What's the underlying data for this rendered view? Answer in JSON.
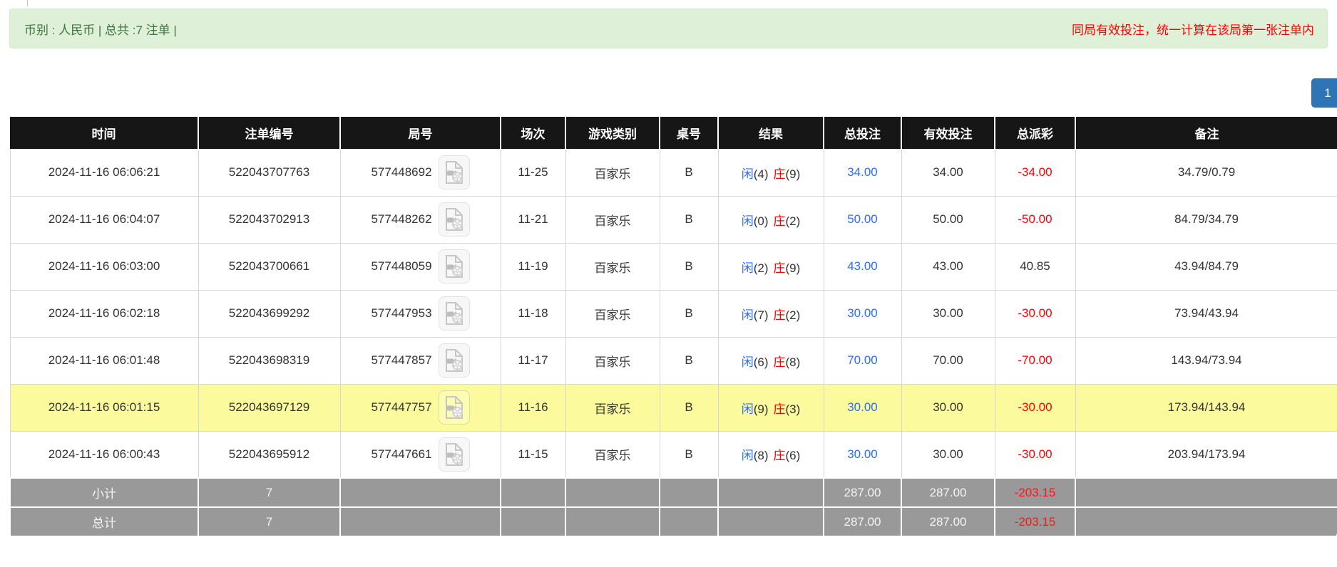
{
  "banner": {
    "left_text": "币别 : 人民币 | 总共 :7 注单 |",
    "right_text": "同局有效投注，统一计算在该局第一张注单内"
  },
  "pagination": {
    "page": "1"
  },
  "icons": {
    "round_action_icon": "video-replay-file-icon"
  },
  "colors": {
    "header_bg": "#161616",
    "banner_bg": "#dff0d8",
    "banner_text": "#3c763d",
    "notice_red": "#ff0000",
    "highlight_row": "#fbfb9d",
    "footer_bg": "#999999",
    "link_blue": "#2b6ff0",
    "player_blue": "#2b6ff0",
    "banker_red": "#ff0000",
    "negative_red": "#ff0000",
    "pagination_bg": "#2e75b6"
  },
  "table": {
    "columns": [
      "时间",
      "注单编号",
      "局号",
      "场次",
      "游戏类别",
      "桌号",
      "结果",
      "总投注",
      "有效投注",
      "总派彩",
      "备注"
    ],
    "rows": [
      {
        "time": "2024-11-16 06:06:21",
        "bet_id": "522043707763",
        "round_id": "577448692",
        "session": "11-25",
        "game": "百家乐",
        "table_no": "B",
        "result": {
          "player": "闲",
          "player_score": "(4)",
          "banker": "庄",
          "banker_score": "(9)"
        },
        "total_bet": "34.00",
        "valid_bet": "34.00",
        "payout": "-34.00",
        "remark": "34.79/0.79",
        "highlight": false
      },
      {
        "time": "2024-11-16 06:04:07",
        "bet_id": "522043702913",
        "round_id": "577448262",
        "session": "11-21",
        "game": "百家乐",
        "table_no": "B",
        "result": {
          "player": "闲",
          "player_score": "(0)",
          "banker": "庄",
          "banker_score": "(2)"
        },
        "total_bet": "50.00",
        "valid_bet": "50.00",
        "payout": "-50.00",
        "remark": "84.79/34.79",
        "highlight": false
      },
      {
        "time": "2024-11-16 06:03:00",
        "bet_id": "522043700661",
        "round_id": "577448059",
        "session": "11-19",
        "game": "百家乐",
        "table_no": "B",
        "result": {
          "player": "闲",
          "player_score": "(2)",
          "banker": "庄",
          "banker_score": "(9)"
        },
        "total_bet": "43.00",
        "valid_bet": "43.00",
        "payout": "40.85",
        "remark": "43.94/84.79",
        "highlight": false
      },
      {
        "time": "2024-11-16 06:02:18",
        "bet_id": "522043699292",
        "round_id": "577447953",
        "session": "11-18",
        "game": "百家乐",
        "table_no": "B",
        "result": {
          "player": "闲",
          "player_score": "(7)",
          "banker": "庄",
          "banker_score": "(2)"
        },
        "total_bet": "30.00",
        "valid_bet": "30.00",
        "payout": "-30.00",
        "remark": "73.94/43.94",
        "highlight": false
      },
      {
        "time": "2024-11-16 06:01:48",
        "bet_id": "522043698319",
        "round_id": "577447857",
        "session": "11-17",
        "game": "百家乐",
        "table_no": "B",
        "result": {
          "player": "闲",
          "player_score": "(6)",
          "banker": "庄",
          "banker_score": "(8)"
        },
        "total_bet": "70.00",
        "valid_bet": "70.00",
        "payout": "-70.00",
        "remark": "143.94/73.94",
        "highlight": false
      },
      {
        "time": "2024-11-16 06:01:15",
        "bet_id": "522043697129",
        "round_id": "577447757",
        "session": "11-16",
        "game": "百家乐",
        "table_no": "B",
        "result": {
          "player": "闲",
          "player_score": "(9)",
          "banker": "庄",
          "banker_score": "(3)"
        },
        "total_bet": "30.00",
        "valid_bet": "30.00",
        "payout": "-30.00",
        "remark": "173.94/143.94",
        "highlight": true
      },
      {
        "time": "2024-11-16 06:00:43",
        "bet_id": "522043695912",
        "round_id": "577447661",
        "session": "11-15",
        "game": "百家乐",
        "table_no": "B",
        "result": {
          "player": "闲",
          "player_score": "(8)",
          "banker": "庄",
          "banker_score": "(6)"
        },
        "total_bet": "30.00",
        "valid_bet": "30.00",
        "payout": "-30.00",
        "remark": "203.94/173.94",
        "highlight": false
      }
    ],
    "footer": [
      {
        "label": "小计",
        "count": "7",
        "total_bet": "287.00",
        "valid_bet": "287.00",
        "payout": "-203.15"
      },
      {
        "label": "总计",
        "count": "7",
        "total_bet": "287.00",
        "valid_bet": "287.00",
        "payout": "-203.15"
      }
    ]
  }
}
